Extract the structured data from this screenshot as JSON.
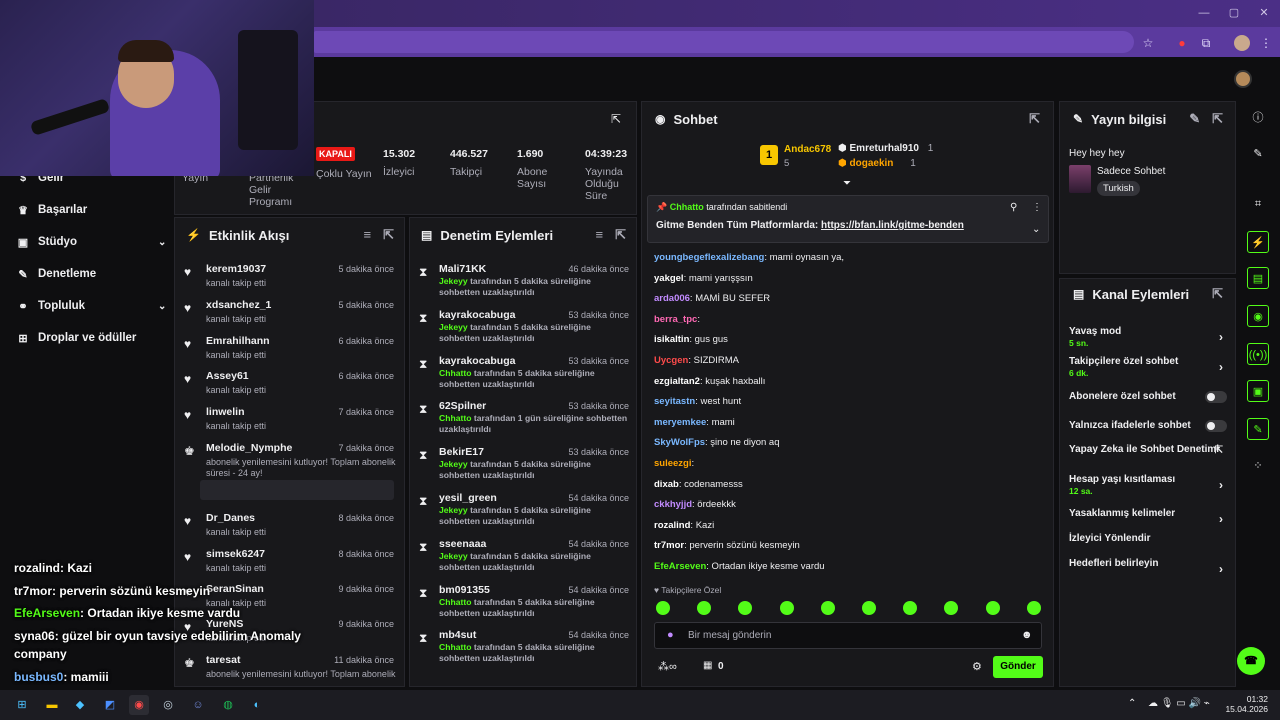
{
  "browser": {
    "window_controls": [
      "—",
      "▢",
      "✕"
    ],
    "toolbar_icons": [
      "star-icon",
      "record-icon",
      "extensions-icon",
      "profile-avatar",
      "menu-icon"
    ]
  },
  "sidebar": {
    "items": [
      {
        "label": "Gelir",
        "icon": "money-icon"
      },
      {
        "label": "Başarılar",
        "icon": "trophy-icon"
      },
      {
        "label": "Stüdyo",
        "icon": "studio-icon",
        "chevron": true
      },
      {
        "label": "Denetleme",
        "icon": "wrench-icon"
      },
      {
        "label": "Topluluk",
        "icon": "community-icon",
        "chevron": true
      },
      {
        "label": "Droplar ve ödüller",
        "icon": "gift-icon"
      }
    ]
  },
  "overlay_chat": [
    {
      "user": "rozalind",
      "msg": ": Kazi",
      "color": "#ffffff"
    },
    {
      "user": "tr7mor",
      "msg": ": perverin sözünü kesmeyin",
      "color": "#ffffff"
    },
    {
      "user": "EfeArseven",
      "msg": ": Ortadan ikiye kesme vardu",
      "color": "#53fc18"
    },
    {
      "user": "syna06",
      "msg": ": güzel bir oyun tavsiye edebilirim Anomaly",
      "color": "#ffffff"
    },
    {
      "user": "",
      "msg": "company",
      "color": "#ffffff"
    },
    {
      "user": "busbus0",
      "msg": ": mamiii",
      "color": "#7ab8ff"
    }
  ],
  "stats": {
    "items": [
      {
        "value": "",
        "label": "Yayın"
      },
      {
        "value": "",
        "label": "Partnerlik Gelir Programı"
      },
      {
        "value": "KAPALI",
        "label": "Çoklu Yayın"
      },
      {
        "value": "15.302",
        "label": "İzleyici"
      },
      {
        "value": "446.527",
        "label": "Takipçi"
      },
      {
        "value": "1.690",
        "label": "Abone Sayısı"
      },
      {
        "value": "04:39:23",
        "label": "Yayında Olduğu Süre"
      }
    ]
  },
  "activity": {
    "title": "Etkinlik Akışı",
    "items": [
      {
        "name": "kerem19037",
        "sub": "kanalı takip etti",
        "time": "5 dakika önce"
      },
      {
        "name": "xdsanchez_1",
        "sub": "kanalı takip etti",
        "time": "5 dakika önce"
      },
      {
        "name": "Emrahilhann",
        "sub": "kanalı takip etti",
        "time": "6 dakika önce"
      },
      {
        "name": "Assey61",
        "sub": "kanalı takip etti",
        "time": "6 dakika önce"
      },
      {
        "name": "linwelin",
        "sub": "kanalı takip etti",
        "time": "7 dakika önce"
      },
      {
        "name": "Melodie_Nymphe",
        "sub": "abonelik yenilemesini kutluyor! Toplam abonelik süresi - 24 ay!",
        "time": "7 dakika önce"
      },
      {
        "name": "Dr_Danes",
        "sub": "kanalı takip etti",
        "time": "8 dakika önce"
      },
      {
        "name": "simsek6247",
        "sub": "kanalı takip etti",
        "time": "8 dakika önce"
      },
      {
        "name": "SeranSinan",
        "sub": "kanalı takip etti",
        "time": "9 dakika önce"
      },
      {
        "name": "YureNS",
        "sub": "kanalı takip etti",
        "time": "9 dakika önce"
      },
      {
        "name": "taresat",
        "sub": "abonelik yenilemesini kutluyor! Toplam abonelik",
        "time": "11 dakika önce"
      }
    ]
  },
  "moderation": {
    "title": "Denetim Eylemleri",
    "items": [
      {
        "name": "Mali71KK",
        "by": "Jekeyy",
        "text": " tarafından 5 dakika süreliğine sohbetten uzaklaştırıldı",
        "time": "46 dakika önce"
      },
      {
        "name": "kayrakocabuga",
        "by": "Jekeyy",
        "text": " tarafından 5 dakika süreliğine sohbetten uzaklaştırıldı",
        "time": "53 dakika önce"
      },
      {
        "name": "kayrakocabuga",
        "by": "Chhatto",
        "text": " tarafından 5 dakika süreliğine sohbetten uzaklaştırıldı",
        "time": "53 dakika önce"
      },
      {
        "name": "62Spilner",
        "by": "Chhatto",
        "text": " tarafından 1 gün süreliğine sohbetten uzaklaştırıldı",
        "time": "53 dakika önce"
      },
      {
        "name": "BekirE17",
        "by": "Jekeyy",
        "text": " tarafından 5 dakika süreliğine sohbetten uzaklaştırıldı",
        "time": "53 dakika önce"
      },
      {
        "name": "yesil_green",
        "by": "Jekeyy",
        "text": " tarafından 5 dakika süreliğine sohbetten uzaklaştırıldı",
        "time": "54 dakika önce"
      },
      {
        "name": "sseenaaa",
        "by": "Jekeyy",
        "text": " tarafından 5 dakika süreliğine sohbetten uzaklaştırıldı",
        "time": "54 dakika önce"
      },
      {
        "name": "bm091355",
        "by": "Chhatto",
        "text": " tarafından 5 dakika süreliğine sohbetten uzaklaştırıldı",
        "time": "54 dakika önce"
      },
      {
        "name": "mb4sut",
        "by": "Chhatto",
        "text": " tarafından 5 dakika süreliğine sohbetten uzaklaştırıldı",
        "time": "54 dakika önce"
      }
    ]
  },
  "chat": {
    "title": "Sohbet",
    "leaders": [
      {
        "rank": "1",
        "name": "Andac678",
        "count": "5"
      },
      {
        "name": "Emreturhal910",
        "count": "1"
      },
      {
        "name": "dogaekin",
        "count": "1"
      }
    ],
    "pinned": {
      "by": "Chhatto",
      "by_suffix": "tarafından sabitlendi",
      "text": "Gitme Benden Tüm Platformlarda: ",
      "link": "https://bfan.link/gitme-benden"
    },
    "messages": [
      {
        "user": "youngbegeflexalizebang",
        "color": "#7ab8ff",
        "msg": ": mami oynasın ya,"
      },
      {
        "user": "yakgel",
        "color": "#ffffff",
        "msg": ": mami yarışşsın"
      },
      {
        "user": "arda006",
        "color": "#c28bff",
        "msg": ": MAMİ BU SEFER"
      },
      {
        "user": "berra_tpc",
        "color": "#ff69b4",
        "msg": ":"
      },
      {
        "user": "isikaltin",
        "color": "#ffffff",
        "msg": ": gus gus"
      },
      {
        "user": "Uycgen",
        "color": "#ff4b4b",
        "msg": ": SIZDIRMA"
      },
      {
        "user": "ezgialtan2",
        "color": "#ffffff",
        "msg": ": kuşak haxballı"
      },
      {
        "user": "seyitastn",
        "color": "#7ab8ff",
        "msg": ": west hunt"
      },
      {
        "user": "meryemkee",
        "color": "#7ab8ff",
        "msg": ": mami"
      },
      {
        "user": "SkyWolFps",
        "color": "#7ab8ff",
        "msg": ": şino ne diyon aq"
      },
      {
        "user": "suleezgi",
        "color": "#ffa500",
        "msg": ":"
      },
      {
        "user": "dixab",
        "color": "#ffffff",
        "msg": ": codenamesss"
      },
      {
        "user": "ckkhyjjd",
        "color": "#c28bff",
        "msg": ": ördeekkk"
      },
      {
        "user": "rozalind",
        "color": "#ffffff",
        "msg": ": Kazi"
      },
      {
        "user": "tr7mor",
        "color": "#ffffff",
        "msg": ": perverin sözünü kesmeyin"
      },
      {
        "user": "EfeArseven",
        "color": "#53fc18",
        "msg": ": Ortadan ikiye kesme vardu"
      }
    ],
    "followers_only": "Takipçilere Özel",
    "input_placeholder": "Bir mesaj gönderin",
    "points": "0",
    "send": "Gönder"
  },
  "stream_info": {
    "title": "Yayın bilgisi",
    "stream_title": "Hey hey hey",
    "category": "Sadece Sohbet",
    "tag": "Turkish"
  },
  "channel_actions": {
    "title": "Kanal Eylemleri",
    "items": [
      {
        "label": "Yavaş mod",
        "value": "5 sn.",
        "type": "arrow"
      },
      {
        "label": "Takipçilere özel sohbet",
        "value": "6 dk.",
        "type": "arrow"
      },
      {
        "label": "Abonelere özel sohbet",
        "value": "",
        "type": "toggle"
      },
      {
        "label": "Yalnızca ifadelerle sohbet",
        "value": "",
        "type": "toggle"
      },
      {
        "label": "Yapay Zeka ile Sohbet Denetimi",
        "value": "",
        "type": "external"
      },
      {
        "label": "Hesap yaşı kısıtlaması",
        "value": "12 sa.",
        "type": "arrow"
      },
      {
        "label": "Yasaklanmış kelimeler",
        "value": "",
        "type": "arrow"
      },
      {
        "label": "İzleyici Yönlendir",
        "value": "",
        "type": "none"
      },
      {
        "label": "Hedefleri belirleyin",
        "value": "",
        "type": "arrow"
      }
    ]
  },
  "taskbar": {
    "time": "01:32",
    "date": "15.04.2026"
  },
  "colors": {
    "accent": "#53fc18",
    "panel": "#18181b",
    "bg": "#0e0e10"
  }
}
